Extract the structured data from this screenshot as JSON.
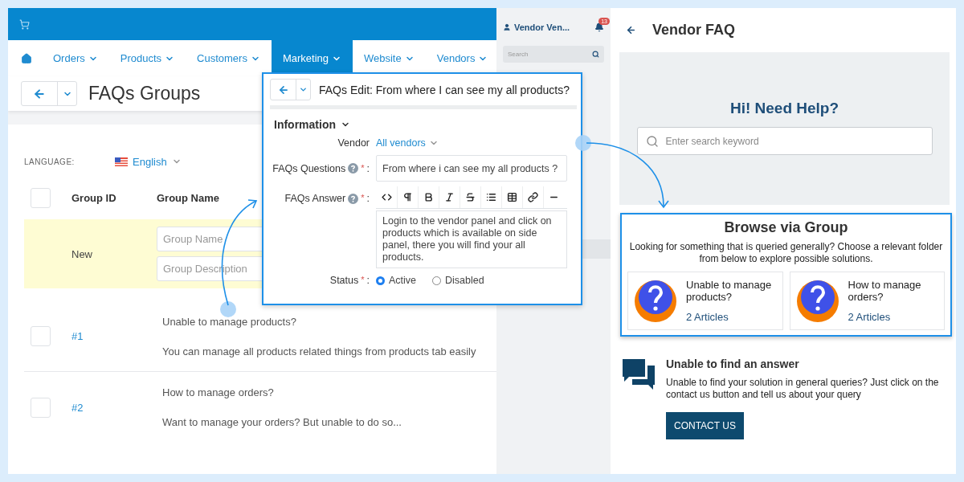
{
  "admin": {
    "nav_items": [
      {
        "label": "Orders",
        "selected": false
      },
      {
        "label": "Products",
        "selected": false
      },
      {
        "label": "Customers",
        "selected": false
      },
      {
        "label": "Marketing",
        "selected": true
      },
      {
        "label": "Website",
        "selected": false
      },
      {
        "label": "Vendors",
        "selected": false
      }
    ],
    "page_title": "FAQs Groups",
    "language_label": "LANGUAGE:",
    "language": "English",
    "table": {
      "select_all_checked": false,
      "columns": [
        "Group ID",
        "Group Name"
      ],
      "new_row": {
        "id": "New",
        "name_placeholder": "Group Name",
        "description_placeholder": "Group Description"
      },
      "rows": [
        {
          "checked": false,
          "id": "#1",
          "title": "Unable to manage products?",
          "description": "You can manage all products related things from products tab easily"
        },
        {
          "checked": false,
          "id": "#2",
          "title": "How to manage orders?",
          "description": "Want to manage your orders? But unable to do so..."
        }
      ]
    }
  },
  "edit_dialog": {
    "title": "FAQs Edit: From where I can see my all products?",
    "section": "Information",
    "vendor": {
      "label": "Vendor",
      "value": "All vendors"
    },
    "question": {
      "label": "FAQs Questions",
      "required_mark": "*",
      "colon": ":",
      "value": "From where i can see my all products ?"
    },
    "answer": {
      "label": "FAQs Answer",
      "required_mark": "*",
      "colon": ":",
      "value": "Login to the vendor panel and click on products which is available on side panel, there you will find your all products."
    },
    "status": {
      "label": "Status",
      "required_mark": "*",
      "colon": ":",
      "options": [
        {
          "label": "Active",
          "selected": true
        },
        {
          "label": "Disabled",
          "selected": false
        }
      ]
    }
  },
  "vendor_sidebar": {
    "user": "Vendor Ven...",
    "badge": "13",
    "search_placeholder": "Search"
  },
  "faq": {
    "title": "Vendor FAQ",
    "hero_title": "Hi! Need Help?",
    "search_placeholder": "Enter search keyword",
    "browse": {
      "title": "Browse via Group",
      "description": "Looking for something that is queried generally? Choose a relevant folder from below to explore possible solutions.",
      "groups": [
        {
          "title": "Unable to manage products?",
          "articles": "2 Articles"
        },
        {
          "title": "How to manage orders?",
          "articles": "2 Articles"
        }
      ]
    },
    "contact": {
      "title": "Unable to find an answer",
      "text": "Unable to find your solution in general queries? Just click on the contact us button and tell us about your query",
      "button": "CONTACT US"
    }
  }
}
